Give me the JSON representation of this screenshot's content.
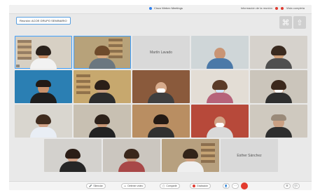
{
  "topbar": {
    "center_text": "Cisco Webex Meetings",
    "right_text": "Información de la reunión",
    "layout_text": "Vista completa",
    "center_dot_color": "#2f80ed",
    "right_dot_color": "#e03a2f"
  },
  "meeting": {
    "chip_text": "Reunión: ACOE GRUPO SEMINARIO"
  },
  "view_buttons": [
    {
      "icon": "grid-icon",
      "glyph": "⌘"
    },
    {
      "icon": "share-icon",
      "glyph": "⇧"
    }
  ],
  "participants": {
    "name_tiles": [
      "Martín Lavado",
      "Esther Sánchez"
    ]
  },
  "bottombar": {
    "buttons": [
      "Silenciar",
      "Detener vídeo",
      "Compartir",
      "Grabación"
    ],
    "end_color": "#e33b2e"
  }
}
